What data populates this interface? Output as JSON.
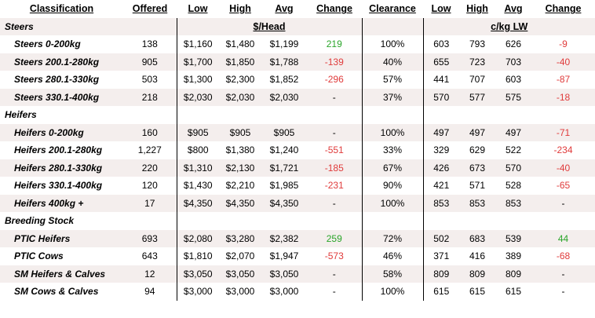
{
  "headers": {
    "classification": "Classification",
    "offered": "Offered",
    "low": "Low",
    "high": "High",
    "avg": "Avg",
    "change": "Change",
    "clearance": "Clearance",
    "low2": "Low",
    "high2": "High",
    "avg2": "Avg",
    "change2": "Change"
  },
  "groups": {
    "head_unit": "$/Head",
    "ckg_unit": "c/kg LW"
  },
  "sections": {
    "steers": "Steers",
    "heifers": "Heifers",
    "breeding": "Breeding Stock"
  },
  "rows": {
    "steers": [
      {
        "name": "Steers 0-200kg",
        "offered": "138",
        "low": "$1,160",
        "high": "$1,480",
        "avg": "$1,199",
        "change": "219",
        "change_sign": "pos",
        "clearance": "100%",
        "low2": "603",
        "high2": "793",
        "avg2": "626",
        "change2": "-9",
        "change2_sign": "neg"
      },
      {
        "name": "Steers 200.1-280kg",
        "offered": "905",
        "low": "$1,700",
        "high": "$1,850",
        "avg": "$1,788",
        "change": "-139",
        "change_sign": "neg",
        "clearance": "40%",
        "low2": "655",
        "high2": "723",
        "avg2": "703",
        "change2": "-40",
        "change2_sign": "neg"
      },
      {
        "name": "Steers 280.1-330kg",
        "offered": "503",
        "low": "$1,300",
        "high": "$2,300",
        "avg": "$1,852",
        "change": "-296",
        "change_sign": "neg",
        "clearance": "57%",
        "low2": "441",
        "high2": "707",
        "avg2": "603",
        "change2": "-87",
        "change2_sign": "neg"
      },
      {
        "name": "Steers 330.1-400kg",
        "offered": "218",
        "low": "$2,030",
        "high": "$2,030",
        "avg": "$2,030",
        "change": "-",
        "change_sign": "none",
        "clearance": "37%",
        "low2": "570",
        "high2": "577",
        "avg2": "575",
        "change2": "-18",
        "change2_sign": "neg"
      }
    ],
    "heifers": [
      {
        "name": "Heifers 0-200kg",
        "offered": "160",
        "low": "$905",
        "high": "$905",
        "avg": "$905",
        "change": "-",
        "change_sign": "none",
        "clearance": "100%",
        "low2": "497",
        "high2": "497",
        "avg2": "497",
        "change2": "-71",
        "change2_sign": "neg"
      },
      {
        "name": "Heifers 200.1-280kg",
        "offered": "1,227",
        "low": "$800",
        "high": "$1,380",
        "avg": "$1,240",
        "change": "-551",
        "change_sign": "neg",
        "clearance": "33%",
        "low2": "329",
        "high2": "629",
        "avg2": "522",
        "change2": "-234",
        "change2_sign": "neg"
      },
      {
        "name": "Heifers 280.1-330kg",
        "offered": "220",
        "low": "$1,310",
        "high": "$2,130",
        "avg": "$1,721",
        "change": "-185",
        "change_sign": "neg",
        "clearance": "67%",
        "low2": "426",
        "high2": "673",
        "avg2": "570",
        "change2": "-40",
        "change2_sign": "neg"
      },
      {
        "name": "Heifers 330.1-400kg",
        "offered": "120",
        "low": "$1,430",
        "high": "$2,210",
        "avg": "$1,985",
        "change": "-231",
        "change_sign": "neg",
        "clearance": "90%",
        "low2": "421",
        "high2": "571",
        "avg2": "528",
        "change2": "-65",
        "change2_sign": "neg"
      },
      {
        "name": "Heifers 400kg +",
        "offered": "17",
        "low": "$4,350",
        "high": "$4,350",
        "avg": "$4,350",
        "change": "-",
        "change_sign": "none",
        "clearance": "100%",
        "low2": "853",
        "high2": "853",
        "avg2": "853",
        "change2": "-",
        "change2_sign": "none"
      }
    ],
    "breeding": [
      {
        "name": "PTIC Heifers",
        "offered": "693",
        "low": "$2,080",
        "high": "$3,280",
        "avg": "$2,382",
        "change": "259",
        "change_sign": "pos",
        "clearance": "72%",
        "low2": "502",
        "high2": "683",
        "avg2": "539",
        "change2": "44",
        "change2_sign": "pos"
      },
      {
        "name": "PTIC Cows",
        "offered": "643",
        "low": "$1,810",
        "high": "$2,070",
        "avg": "$1,947",
        "change": "-573",
        "change_sign": "neg",
        "clearance": "46%",
        "low2": "371",
        "high2": "416",
        "avg2": "389",
        "change2": "-68",
        "change2_sign": "neg"
      },
      {
        "name": "SM Heifers & Calves",
        "offered": "12",
        "low": "$3,050",
        "high": "$3,050",
        "avg": "$3,050",
        "change": "-",
        "change_sign": "none",
        "clearance": "58%",
        "low2": "809",
        "high2": "809",
        "avg2": "809",
        "change2": "-",
        "change2_sign": "none"
      },
      {
        "name": "SM Cows & Calves",
        "offered": "94",
        "low": "$3,000",
        "high": "$3,000",
        "avg": "$3,000",
        "change": "-",
        "change_sign": "none",
        "clearance": "100%",
        "low2": "615",
        "high2": "615",
        "avg2": "615",
        "change2": "-",
        "change2_sign": "none"
      }
    ]
  },
  "colors": {
    "positive": "#2aa52a",
    "negative": "#e03b3b",
    "stripe": "#f4eeed"
  }
}
